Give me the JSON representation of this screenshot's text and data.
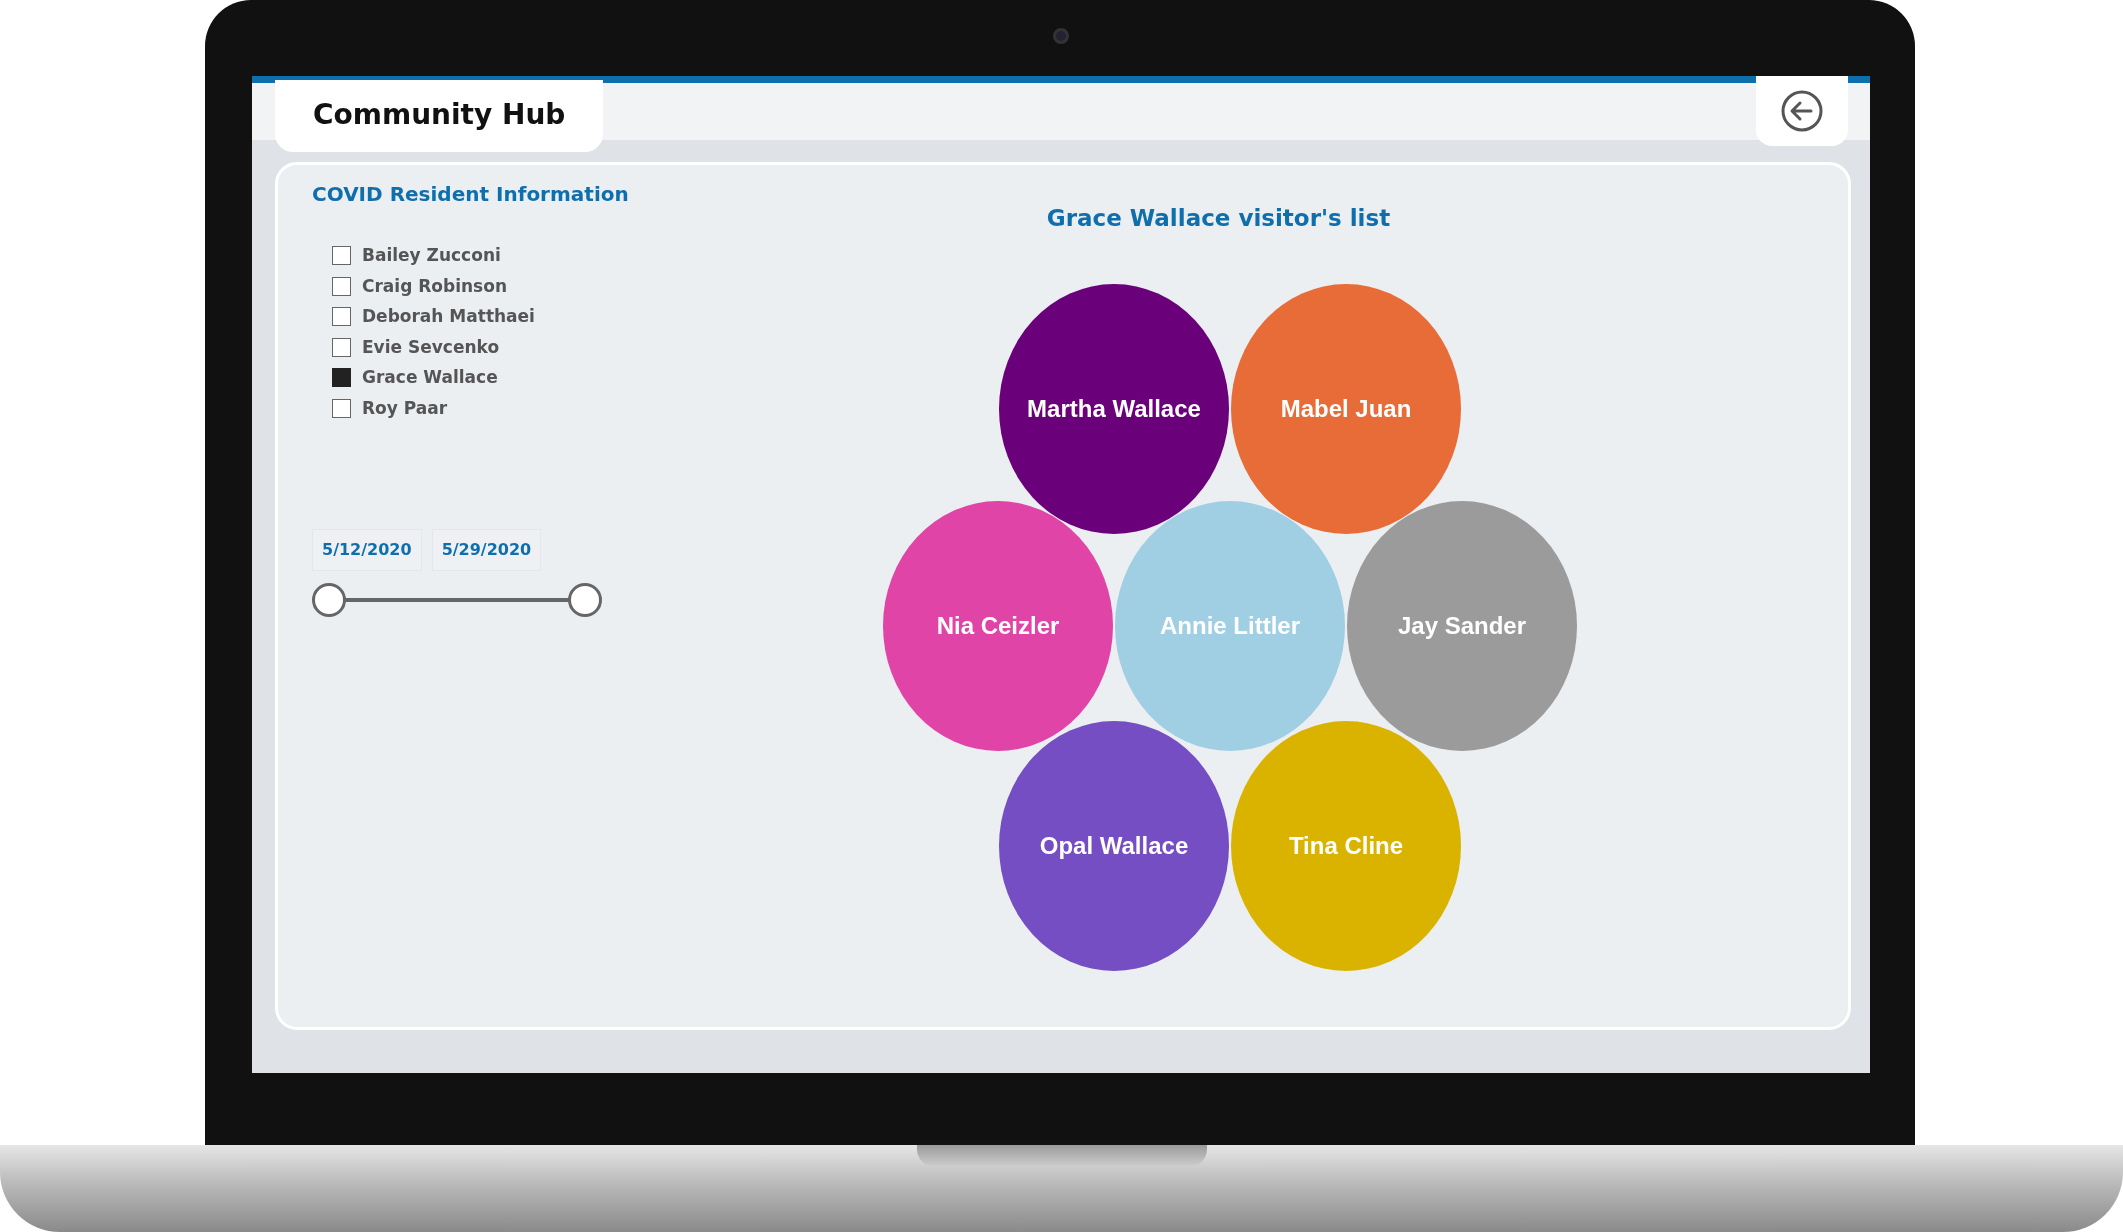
{
  "app": {
    "title": "Community Hub"
  },
  "panel": {
    "title": "COVID Resident Information"
  },
  "residents": [
    {
      "name": "Bailey Zucconi",
      "checked": false
    },
    {
      "name": "Craig Robinson",
      "checked": false
    },
    {
      "name": "Deborah Matthaei",
      "checked": false
    },
    {
      "name": "Evie Sevcenko",
      "checked": false
    },
    {
      "name": "Grace Wallace",
      "checked": true
    },
    {
      "name": "Roy Paar",
      "checked": false
    }
  ],
  "date_range": {
    "start": "5/12/2020",
    "end": "5/29/2020",
    "thumbs": [
      {
        "level": 0
      },
      {
        "level": 1
      }
    ]
  },
  "visitors_chart": {
    "title": "Grace Wallace visitor's list",
    "visitors": [
      {
        "name": "Martha Wallace",
        "color": "#6a007a"
      },
      {
        "name": "Mabel Juan",
        "color": "#e76c37"
      },
      {
        "name": "Nia Ceizler",
        "color": "#e044a7"
      },
      {
        "name": "Annie Littler",
        "color": "#a0cee3"
      },
      {
        "name": "Jay Sander",
        "color": "#9b9b9b"
      },
      {
        "name": "Opal Wallace",
        "color": "#744ec2"
      },
      {
        "name": "Tina Cline",
        "color": "#d9b300"
      }
    ]
  }
}
